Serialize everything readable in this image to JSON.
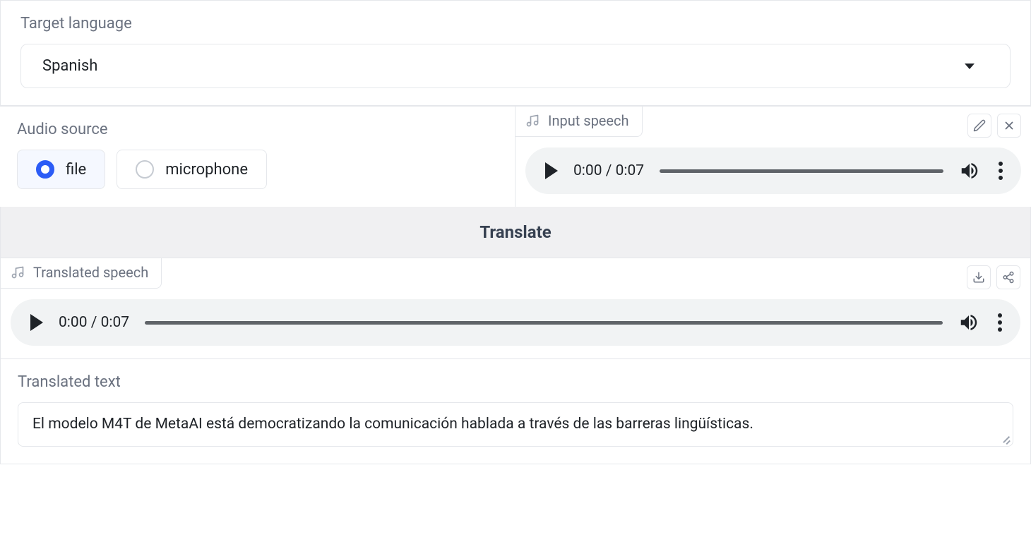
{
  "targetLanguage": {
    "label": "Target language",
    "value": "Spanish"
  },
  "audioSource": {
    "label": "Audio source",
    "options": {
      "file": "file",
      "microphone": "microphone"
    },
    "selected": "file"
  },
  "inputSpeech": {
    "label": "Input speech",
    "player": {
      "current": "0:00",
      "duration": "0:07"
    }
  },
  "translateButton": "Translate",
  "translatedSpeech": {
    "label": "Translated speech",
    "player": {
      "current": "0:00",
      "duration": "0:07"
    }
  },
  "translatedText": {
    "label": "Translated text",
    "value": "El modelo M4T de MetaAI está democratizando la comunicación hablada a través de las barreras lingüísticas."
  }
}
